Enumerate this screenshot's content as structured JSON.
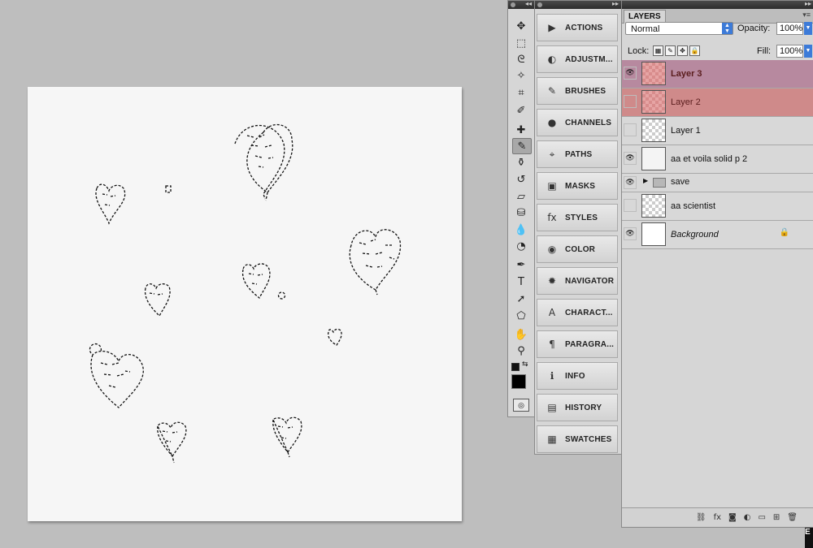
{
  "tools_panel": {
    "icons": [
      "move-icon",
      "marquee-icon",
      "lasso-icon",
      "magic-wand-icon",
      "crop-icon",
      "eyedropper-icon",
      "healing-brush-icon",
      "brush-icon",
      "clone-stamp-icon",
      "history-brush-icon",
      "eraser-icon",
      "paint-bucket-icon",
      "blur-icon",
      "dodge-icon",
      "pen-icon",
      "type-icon",
      "path-selection-icon",
      "shape-icon",
      "hand-icon",
      "zoom-icon"
    ],
    "type_glyph": "T"
  },
  "dock": {
    "items": [
      {
        "label": "ACTIONS",
        "icon": "actions-icon",
        "glyph": "▶"
      },
      {
        "label": "ADJUSTM...",
        "icon": "adjustments-icon",
        "glyph": "◐"
      },
      {
        "label": "BRUSHES",
        "icon": "brushes-icon",
        "glyph": "✎"
      },
      {
        "label": "CHANNELS",
        "icon": "channels-icon",
        "glyph": "●"
      },
      {
        "label": "PATHS",
        "icon": "paths-icon",
        "glyph": "⌖"
      },
      {
        "label": "MASKS",
        "icon": "masks-icon",
        "glyph": "▣"
      },
      {
        "label": "STYLES",
        "icon": "styles-icon",
        "glyph": "fx"
      },
      {
        "label": "COLOR",
        "icon": "color-icon",
        "glyph": "◉"
      },
      {
        "label": "NAVIGATOR",
        "icon": "navigator-icon",
        "glyph": "✹"
      },
      {
        "label": "CHARACT...",
        "icon": "character-icon",
        "glyph": "A"
      },
      {
        "label": "PARAGRA...",
        "icon": "paragraph-icon",
        "glyph": "¶"
      },
      {
        "label": "INFO",
        "icon": "info-icon",
        "glyph": "ℹ"
      },
      {
        "label": "HISTORY",
        "icon": "history-icon",
        "glyph": "▤"
      },
      {
        "label": "SWATCHES",
        "icon": "swatches-icon",
        "glyph": "▦"
      }
    ]
  },
  "layers_panel": {
    "tab": "LAYERS",
    "blend_mode": "Normal",
    "opacity_label": "Opacity:",
    "opacity": "100%",
    "lock_label": "Lock:",
    "fill_label": "Fill:",
    "fill": "100%",
    "layers": [
      {
        "name": "Layer 3",
        "visible": true,
        "state": "selected-primary"
      },
      {
        "name": "Layer 2",
        "visible": false,
        "state": "selected"
      },
      {
        "name": "Layer 1",
        "visible": false,
        "state": ""
      },
      {
        "name": "aa et voila solid p 2",
        "visible": true,
        "state": ""
      },
      {
        "name": "save",
        "visible": true,
        "state": "group"
      },
      {
        "name": "aa scientist",
        "visible": false,
        "state": ""
      },
      {
        "name": "Background",
        "visible": true,
        "state": "locked"
      }
    ]
  },
  "colors": {
    "selected_primary": "#b7899f",
    "selected": "#cf8a8a",
    "canvas": "#f6f6f6",
    "workspace": "#bebebe"
  },
  "edge_text": "E"
}
